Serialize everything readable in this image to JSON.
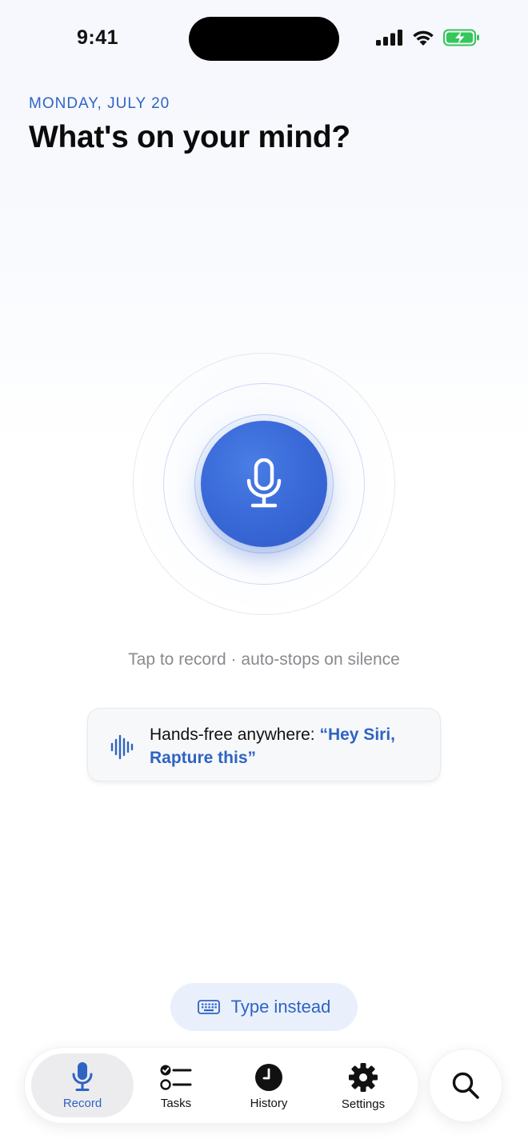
{
  "status_bar": {
    "time": "9:41"
  },
  "header": {
    "date": "MONDAY, JULY 20",
    "title": "What's on your mind?"
  },
  "record": {
    "hint": "Tap to record · auto-stops on silence"
  },
  "siri_card": {
    "prefix": "Hands-free anywhere: ",
    "phrase": "“Hey Siri, Rapture this”"
  },
  "type_instead": {
    "label": "Type instead"
  },
  "tabs": [
    {
      "label": "Record",
      "icon": "mic-icon",
      "active": true
    },
    {
      "label": "Tasks",
      "icon": "checklist-icon",
      "active": false
    },
    {
      "label": "History",
      "icon": "clock-icon",
      "active": false
    },
    {
      "label": "Settings",
      "icon": "gear-icon",
      "active": false
    }
  ],
  "colors": {
    "accent": "#2f63c4",
    "mic_button": "#3a6bd9",
    "battery": "#34c759"
  }
}
